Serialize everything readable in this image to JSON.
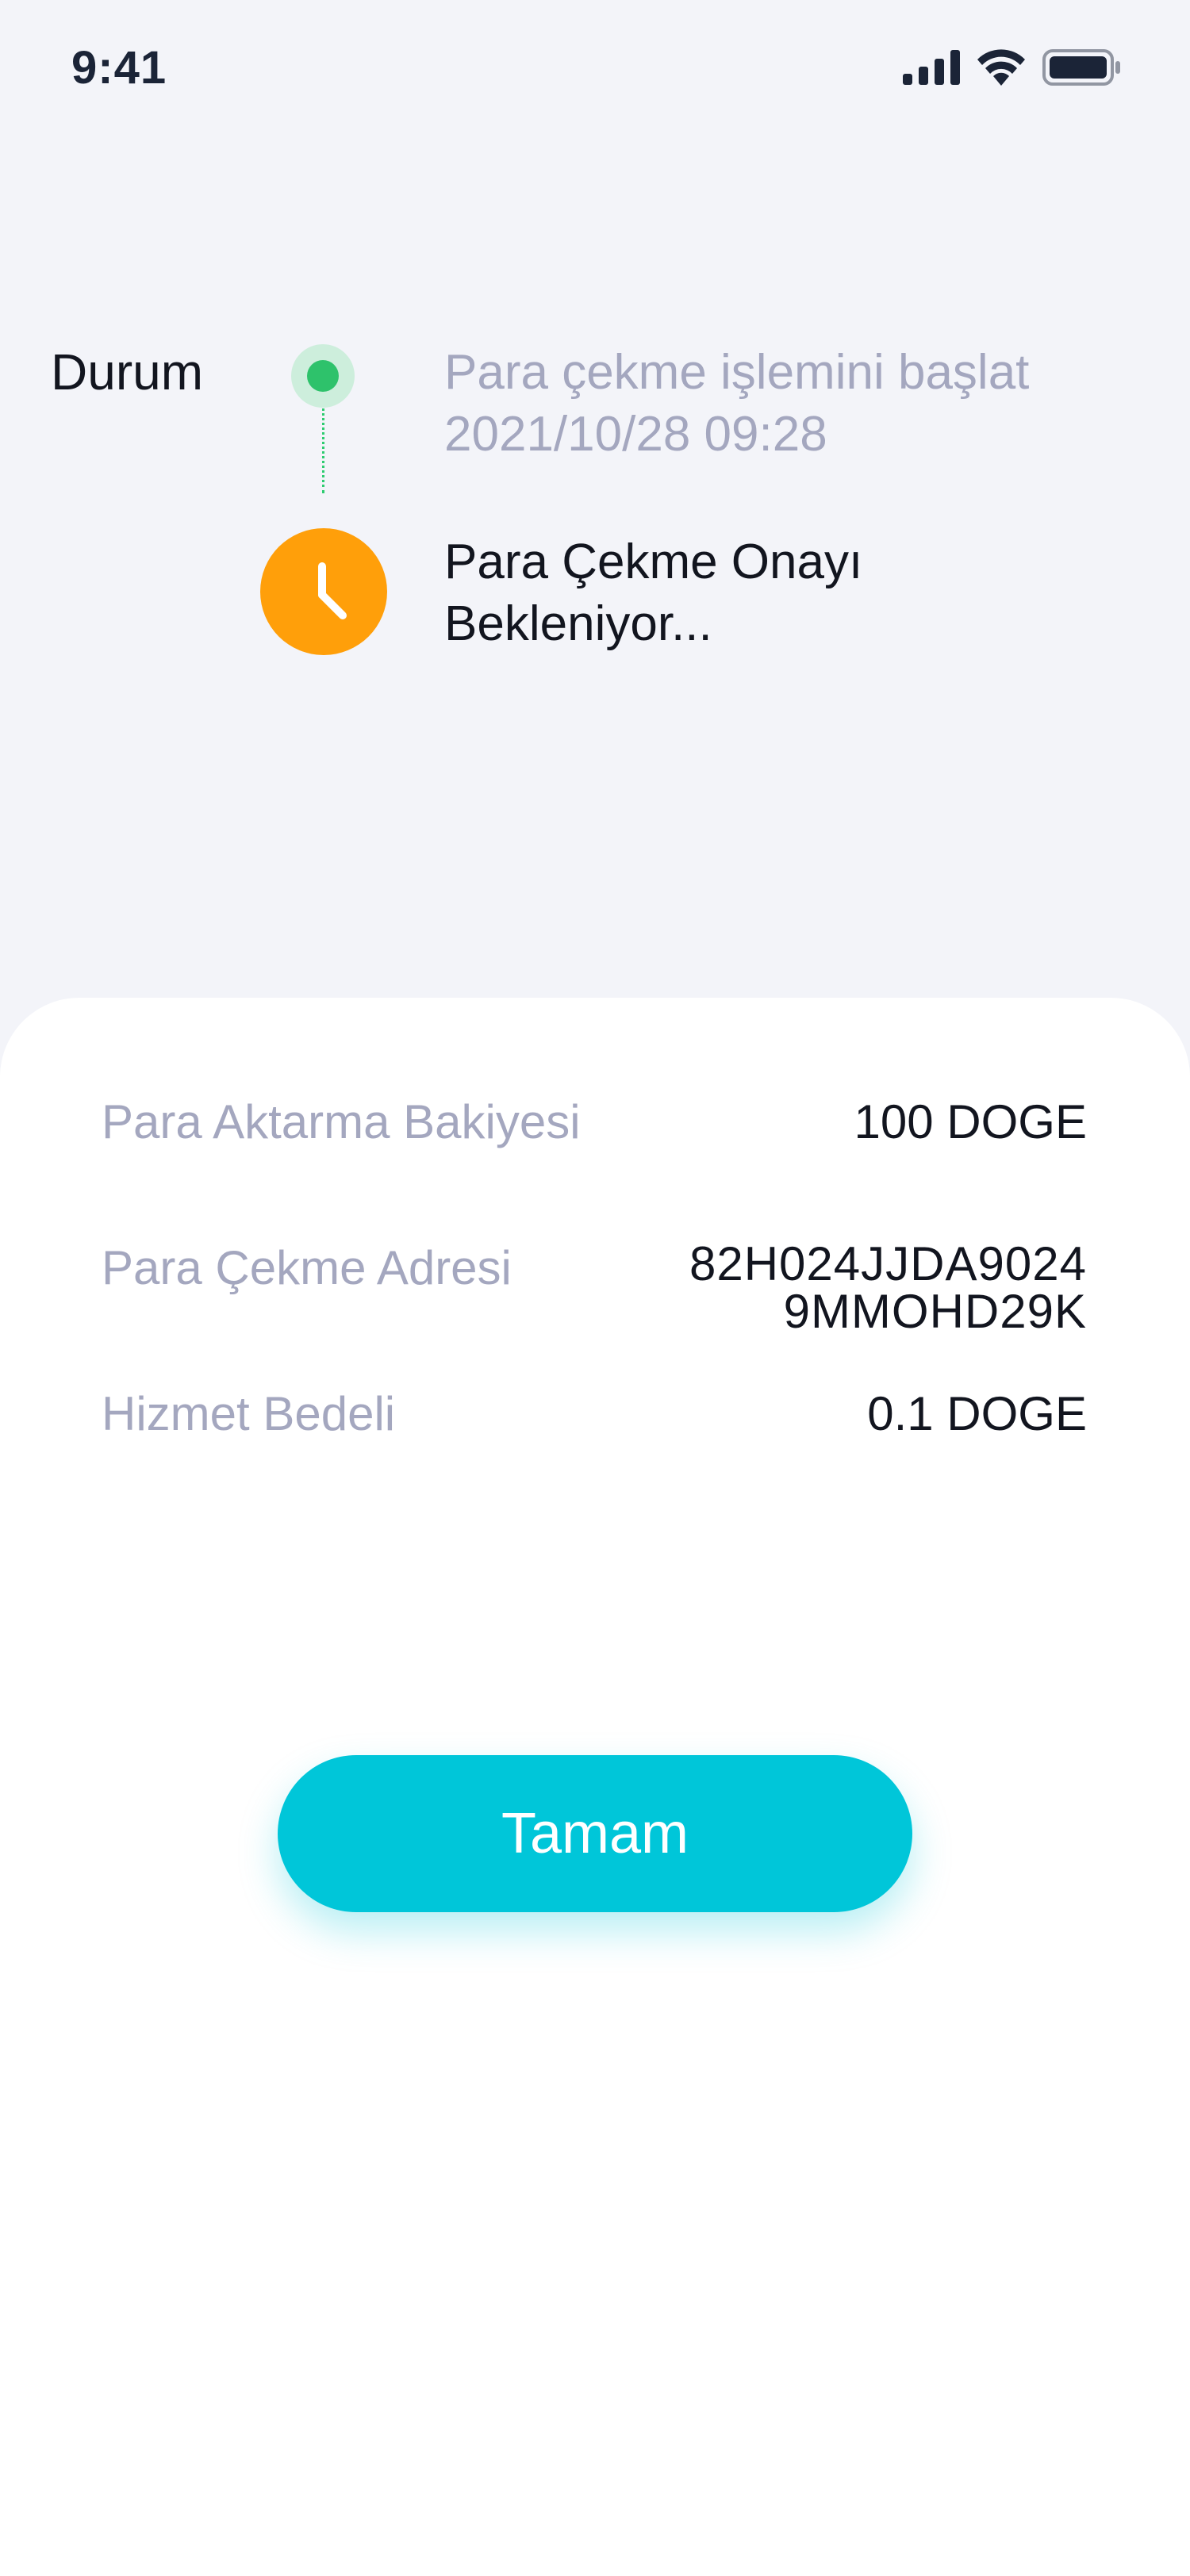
{
  "status_bar": {
    "time": "9:41",
    "icons": [
      "cellular-signal-icon",
      "wifi-icon",
      "battery-icon"
    ]
  },
  "status": {
    "label": "Durum",
    "steps": [
      {
        "title": "Para çekme işlemini başlat",
        "timestamp": "2021/10/28 09:28",
        "state": "done"
      },
      {
        "title": "Para Çekme Onayı Bekleniyor...",
        "state": "pending"
      }
    ]
  },
  "details": [
    {
      "label": "Para Aktarma Bakiyesi",
      "value": "100 DOGE"
    },
    {
      "label": "Para Çekme Adresi",
      "value_lines": [
        "82H024JJDA9024",
        "9MMOHD29K"
      ]
    },
    {
      "label": "Hizmet Bedeli",
      "value": "0.1 DOGE"
    }
  ],
  "actions": {
    "ok_label": "Tamam"
  },
  "colors": {
    "background": "#f3f4f9",
    "accent": "#00c6d9",
    "done": "#2ec26b",
    "pending": "#ff9f0a",
    "muted_text": "#a4a7bf"
  }
}
